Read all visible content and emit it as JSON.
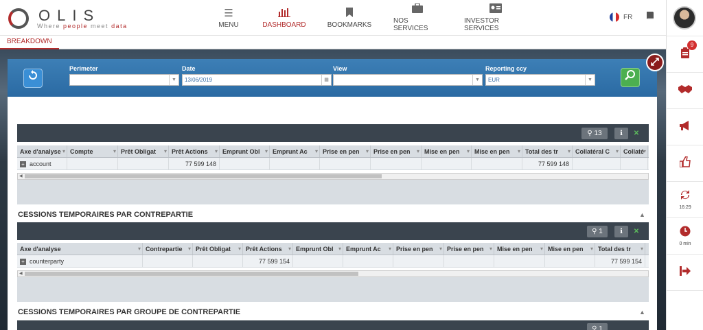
{
  "brand": {
    "logo_text": "OLIS",
    "tagline_pre": "Where ",
    "tagline_red": "people",
    "tagline_mid": " meet ",
    "tagline_red2": "data"
  },
  "nav": [
    {
      "label": "MENU",
      "icon": "menu-icon"
    },
    {
      "label": "DASHBOARD",
      "icon": "bar-chart-icon",
      "active": true
    },
    {
      "label": "BOOKMARKS",
      "icon": "bookmark-icon"
    },
    {
      "label": "NOS SERVICES",
      "icon": "briefcase-icon"
    },
    {
      "label": "INVESTOR SERVICES",
      "icon": "id-card-icon"
    }
  ],
  "lang": "FR",
  "rail": {
    "badge": "9",
    "refresh_time": "16:29",
    "timer": "0 min"
  },
  "tab": "BREAKDOWN",
  "filters": {
    "perimeter_label": "Perimeter",
    "perimeter_value": "",
    "date_label": "Date",
    "date_value": "13/06/2019",
    "view_label": "View",
    "view_value": "",
    "ccy_label": "Reporting ccy",
    "ccy_value": "EUR"
  },
  "grid1": {
    "count": "13",
    "columns": [
      "Axe d'analyse",
      "Compte",
      "Prêt Obligat",
      "Prêt Actions",
      "Emprunt Obl",
      "Emprunt Ac",
      "Prise en pen",
      "Prise en pen",
      "Mise en pen",
      "Mise en pen",
      "Total des tr",
      "Collatéral C",
      "Collaté"
    ],
    "row": [
      "account",
      "",
      "",
      "77 599 148",
      "",
      "",
      "",
      "",
      "",
      "",
      "77 599 148",
      "",
      ""
    ]
  },
  "section2": {
    "title": "CESSIONS TEMPORAIRES PAR CONTREPARTIE"
  },
  "grid2": {
    "count": "1",
    "columns": [
      "Axe d'analyse",
      "Contrepartie",
      "Prêt Obligat",
      "Prêt Actions",
      "Emprunt Obl",
      "Emprunt Ac",
      "Prise en pen",
      "Prise en pen",
      "Mise en pen",
      "Mise en pen",
      "Total des tr"
    ],
    "row": [
      "counterparty",
      "",
      "",
      "77 599 154",
      "",
      "",
      "",
      "",
      "",
      "",
      "77 599 154"
    ]
  },
  "section3": {
    "title": "CESSIONS TEMPORAIRES PAR GROUPE DE CONTREPARTIE"
  },
  "grid3": {
    "count": "1"
  }
}
